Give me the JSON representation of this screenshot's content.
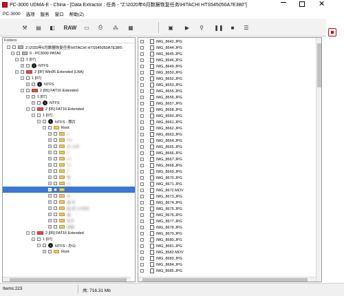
{
  "window": {
    "title": "PC-3000 UDMA-E - China - [Data Extractor : 任务 - \"Z:\\2020年6月数据恢复任务\\HITACHI HTS545050A7E380\"]",
    "minimize_icon": "minimize-icon",
    "maximize_icon": "maximize-icon",
    "close_icon": "close-icon"
  },
  "menu": [
    "PC-3000",
    "选项",
    "服务",
    "窗口",
    "帮助(Z)"
  ],
  "toolbar": {
    "raw_label": "RAW",
    "icons": [
      "tools-icon",
      "scroll-icon",
      "scan-icon",
      "hdd-icon",
      "print-icon",
      "chip-icon",
      "copy-icon",
      "play-icon",
      "bike-icon",
      "pause-icon",
      "stop-icon",
      "list-icon",
      "export-icon"
    ]
  },
  "folders_panel": {
    "header": "Folders",
    "tree": [
      {
        "label": "Z:\\2020年6月数据恢复任务\\HITACHI HTS545050A7E380\\",
        "toggle": "-",
        "icon": "drive"
      },
      {
        "label": "0 - PC3000 PATA0",
        "toggle": "-",
        "icon": "drive"
      },
      {
        "label": "1 [07]",
        "toggle": "-",
        "icon": "none"
      },
      {
        "label": "NTFS",
        "toggle": "+",
        "icon": "ntfs"
      },
      {
        "label": "2 [0F] Win95 Extended  (LBA)",
        "toggle": "-",
        "icon": "fat"
      },
      {
        "label": "1 [07]",
        "toggle": "-",
        "icon": "none"
      },
      {
        "label": "NTFS",
        "toggle": "+",
        "icon": "ntfs"
      },
      {
        "label": "2 [05] FAT16 Extended",
        "toggle": "-",
        "icon": "fat"
      },
      {
        "label": "1 [07]",
        "toggle": "-",
        "icon": "none"
      },
      {
        "label": "NTFS",
        "toggle": "+",
        "icon": "ntfs"
      },
      {
        "label": "2 [05] FAT16 Extended",
        "toggle": "-",
        "icon": "fat"
      },
      {
        "label": "1 [07]",
        "toggle": "-",
        "icon": "none"
      },
      {
        "label": "NTFS - 照片",
        "toggle": "-",
        "icon": "ntfs"
      },
      {
        "label": "Root",
        "toggle": "-",
        "icon": "folder"
      },
      {
        "label": "d",
        "toggle": "+",
        "icon": "folder",
        "blur": true
      },
      {
        "label": "CU",
        "toggle": "+",
        "icon": "folder",
        "blur": true
      },
      {
        "label": "天                15年",
        "toggle": "+",
        "icon": "folder",
        "blur": true
      },
      {
        "label": "2",
        "toggle": "+",
        "icon": "folder",
        "blur": true
      },
      {
        "label": "Lu",
        "toggle": "+",
        "icon": "folder",
        "blur": true
      },
      {
        "label": "Lu",
        "toggle": "+",
        "icon": "folder",
        "blur": true
      },
      {
        "label": "V",
        "toggle": "+",
        "icon": "folder",
        "blur": true
      },
      {
        "label": "第",
        "toggle": "+",
        "icon": "folder",
        "blur": true
      },
      {
        "label": "川",
        "toggle": "+",
        "icon": "folder",
        "blur": true
      },
      {
        "label": "北",
        "toggle": "+",
        "icon": "folder",
        "blur": true,
        "selected": true
      },
      {
        "label": "东",
        "toggle": "+",
        "icon": "folder",
        "blur": true
      },
      {
        "label": "插             年",
        "toggle": "+",
        "icon": "folder",
        "blur": true
      },
      {
        "label": "插          双               21月初)",
        "toggle": "+",
        "icon": "folder",
        "blur": true
      },
      {
        "label": "插",
        "toggle": "+",
        "icon": "folder",
        "blur": true
      },
      {
        "label": "名字",
        "toggle": "+",
        "icon": "folder",
        "blur": true
      },
      {
        "label": "选题",
        "toggle": "+",
        "icon": "folder",
        "blur": true
      },
      {
        "label": "2 [05] FAT16 Extended",
        "toggle": "-",
        "icon": "fat"
      },
      {
        "label": "1 [07]",
        "toggle": "-",
        "icon": "none"
      },
      {
        "label": "NTFS - 办公",
        "toggle": "-",
        "icon": "ntfs"
      },
      {
        "label": "Root",
        "toggle": "+",
        "icon": "folder"
      }
    ]
  },
  "files_panel": {
    "files": [
      "IMG_8642.JPG",
      "IMG_8644.JPG",
      "IMG_8645.JPG",
      "IMG_8646.JPG",
      "IMG_8649.JPG",
      "IMG_8650.JPG",
      "IMG_8652.JPG",
      "IMG_8653.JPG",
      "IMG_8655.JPG",
      "IMG_8656.JPG",
      "IMG_8657.JPG",
      "IMG_8658.JPG",
      "IMG_8660.JPG",
      "IMG_8661.JPG",
      "IMG_8662.JPG",
      "IMG_8663.JPG",
      "IMG_8664.JPG",
      "IMG_8665.JPG",
      "IMG_8666.JPG",
      "IMG_8667.JPG",
      "IMG_8668.JPG",
      "IMG_8669.JPG",
      "IMG_8670.JPG",
      "IMG_8671.JPG",
      "IMG_8672.MOV",
      "IMG_8673.JPG",
      "IMG_8674.JPG",
      "IMG_8675.JPG",
      "IMG_8676.JPG",
      "IMG_8677.JPG",
      "IMG_8678.JPG",
      "IMG_8679.JPG",
      "IMG_8680.JPG",
      "IMG_8681.JPG",
      "IMG_8682.MOV",
      "IMG_8683.JPG",
      "IMG_8684.JPG",
      "IMG_8685.JPG"
    ]
  },
  "status": {
    "items_label": "Items:223",
    "total_label": "共: 716.31 Mb"
  }
}
